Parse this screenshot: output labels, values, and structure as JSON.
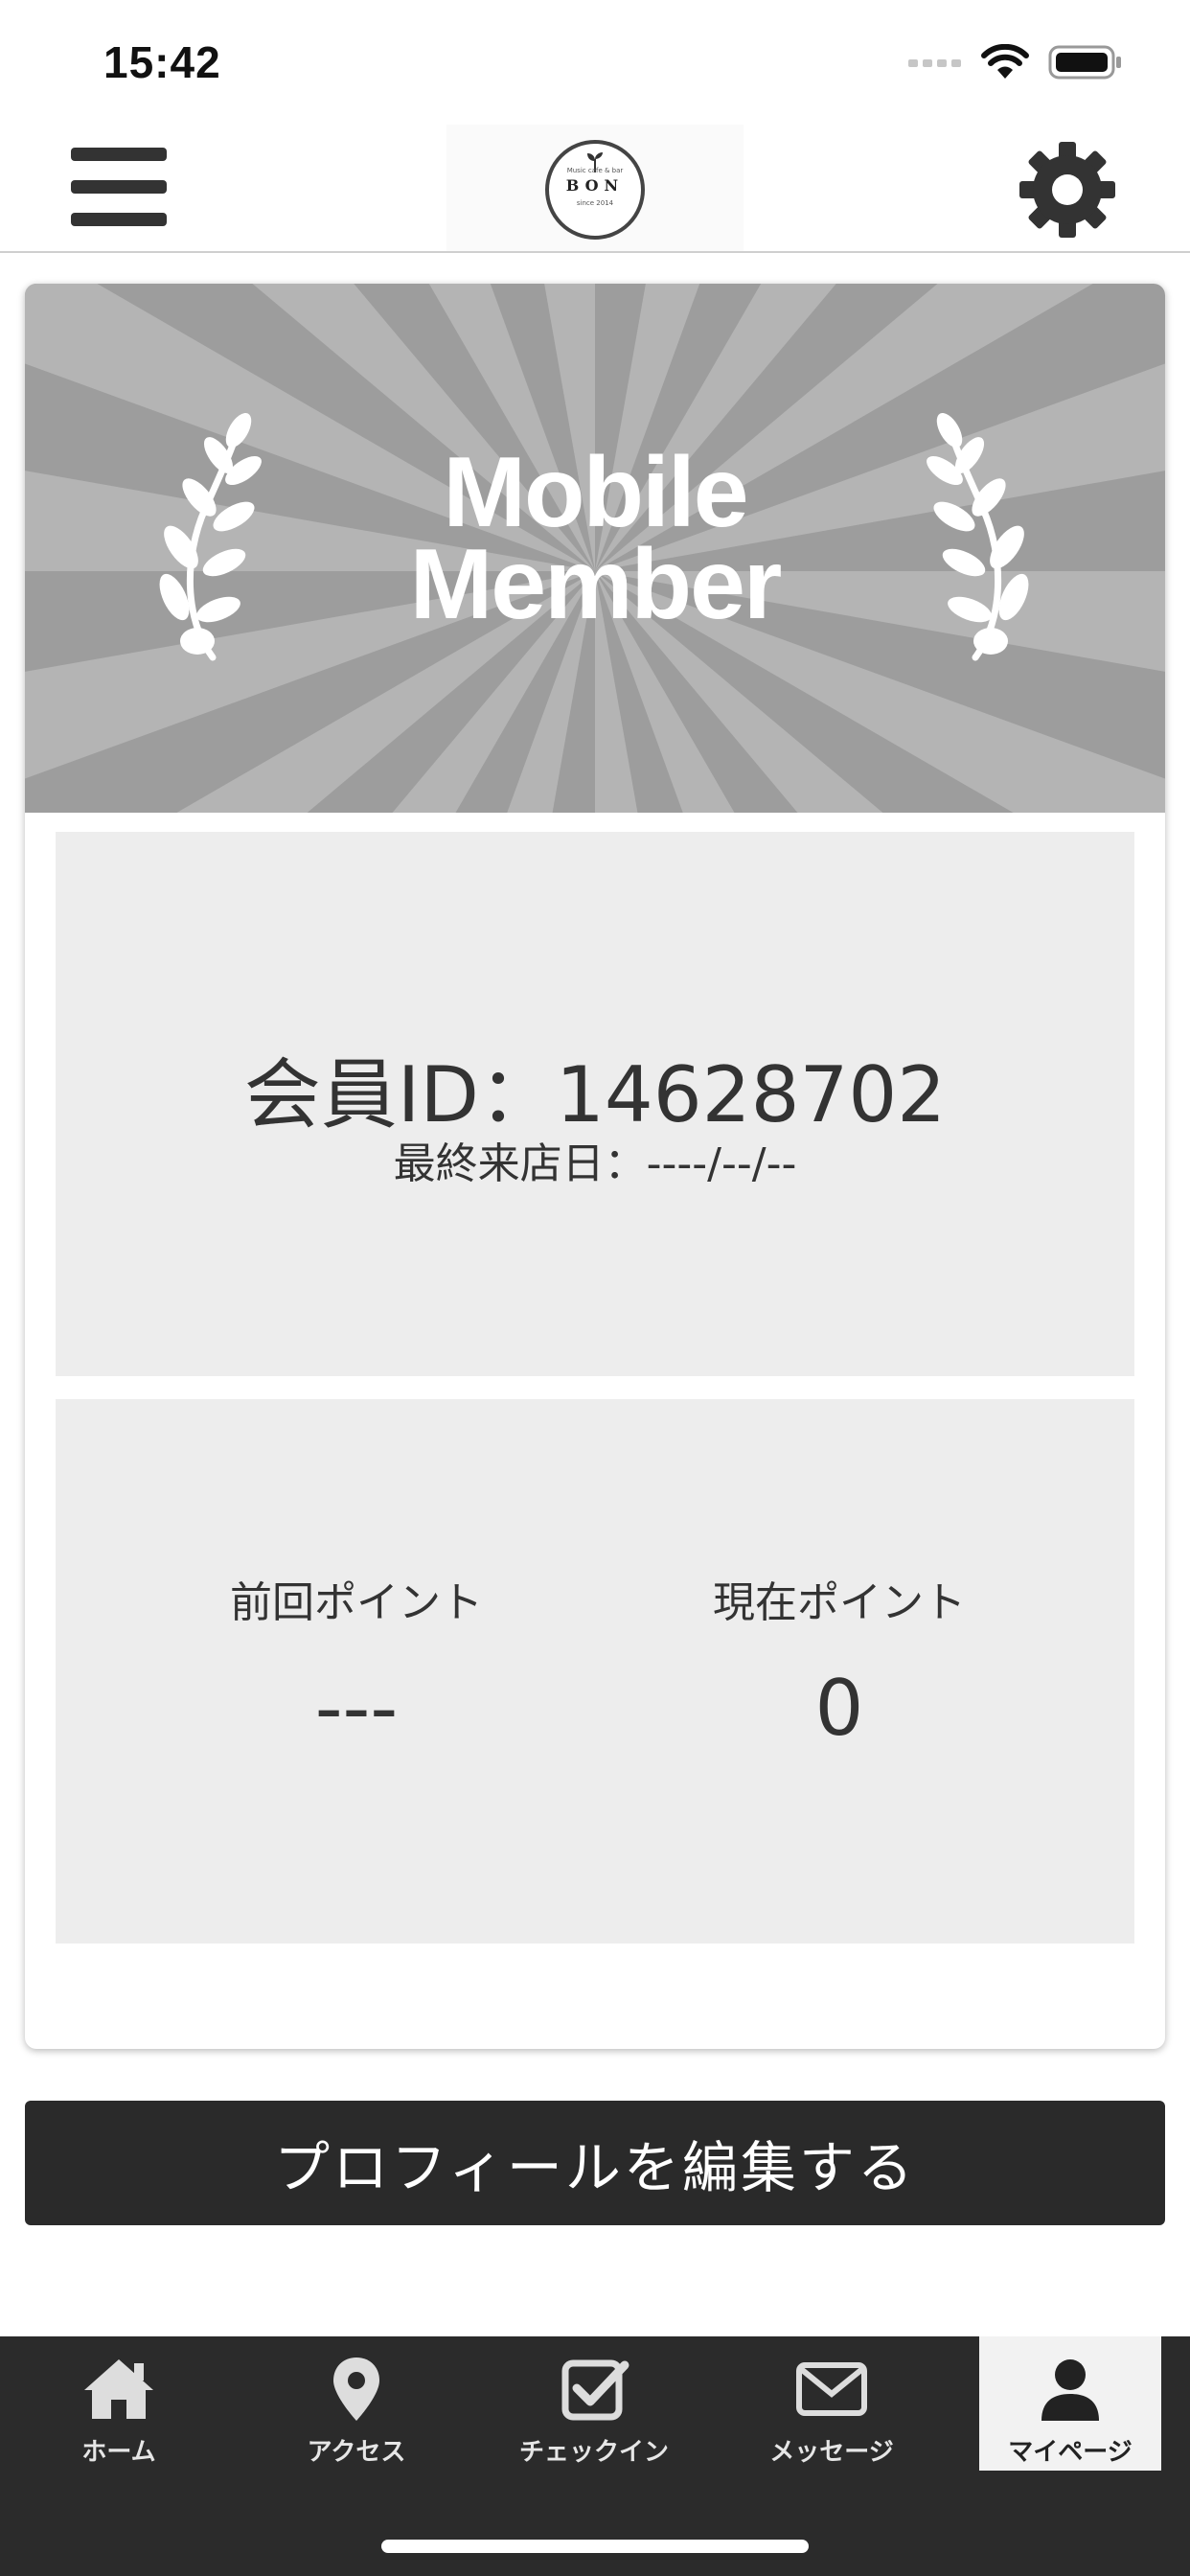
{
  "status_bar": {
    "time": "15:42"
  },
  "header": {
    "logo_name": "BON",
    "logo_tagline": "Music cafe & bar",
    "logo_since": "since 2014"
  },
  "banner": {
    "line1": "Mobile",
    "line2": "Member"
  },
  "member": {
    "id_text": "会員ID：14628702",
    "last_visit_text": "最終来店日：----/--/--"
  },
  "points": {
    "previous_label": "前回ポイント",
    "previous_value": "---",
    "current_label": "現在ポイント",
    "current_value": "0"
  },
  "actions": {
    "edit_profile_label": "プロフィールを編集する"
  },
  "tabbar": {
    "items": [
      {
        "label": "ホーム",
        "icon": "home-icon"
      },
      {
        "label": "アクセス",
        "icon": "location-pin-icon"
      },
      {
        "label": "チェックイン",
        "icon": "checkbox-icon"
      },
      {
        "label": "メッセージ",
        "icon": "mail-icon"
      },
      {
        "label": "マイページ",
        "icon": "person-icon"
      }
    ],
    "active_index": 4
  },
  "colors": {
    "banner_bg": "#9d9d9d",
    "panel_bg": "#ededed",
    "button_bg": "#2a2a2a",
    "tabbar_bg": "#2b2b2b"
  }
}
